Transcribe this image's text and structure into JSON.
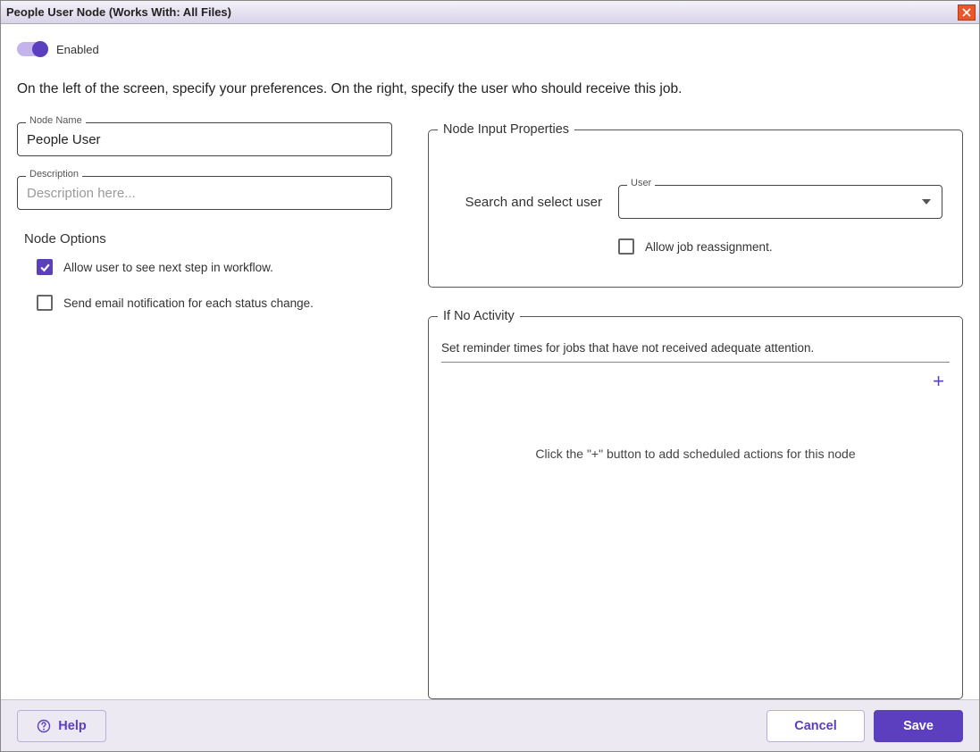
{
  "window": {
    "title": "People User Node (Works With: All Files)"
  },
  "enabled": {
    "label": "Enabled",
    "value": true
  },
  "intro": "On the left of the screen, specify your preferences. On the right, specify the user who should receive this job.",
  "left": {
    "nodeName": {
      "label": "Node Name",
      "value": "People User"
    },
    "description": {
      "label": "Description",
      "placeholder": "Description here...",
      "value": ""
    },
    "optionsTitle": "Node Options",
    "optAllowSee": {
      "label": "Allow user to see next step in workflow.",
      "checked": true
    },
    "optEmail": {
      "label": "Send email notification for each status change.",
      "checked": false
    }
  },
  "nip": {
    "legend": "Node Input Properties",
    "searchLabel": "Search and select user",
    "userLabel": "User",
    "userValue": "",
    "reassign": {
      "label": "Allow job reassignment.",
      "checked": false
    }
  },
  "noActivity": {
    "legend": "If No Activity",
    "reminderText": "Set reminder times for jobs that have not received adequate attention.",
    "emptyMsg": "Click the \"+\" button to add scheduled actions for this node"
  },
  "footer": {
    "help": "Help",
    "cancel": "Cancel",
    "save": "Save"
  }
}
